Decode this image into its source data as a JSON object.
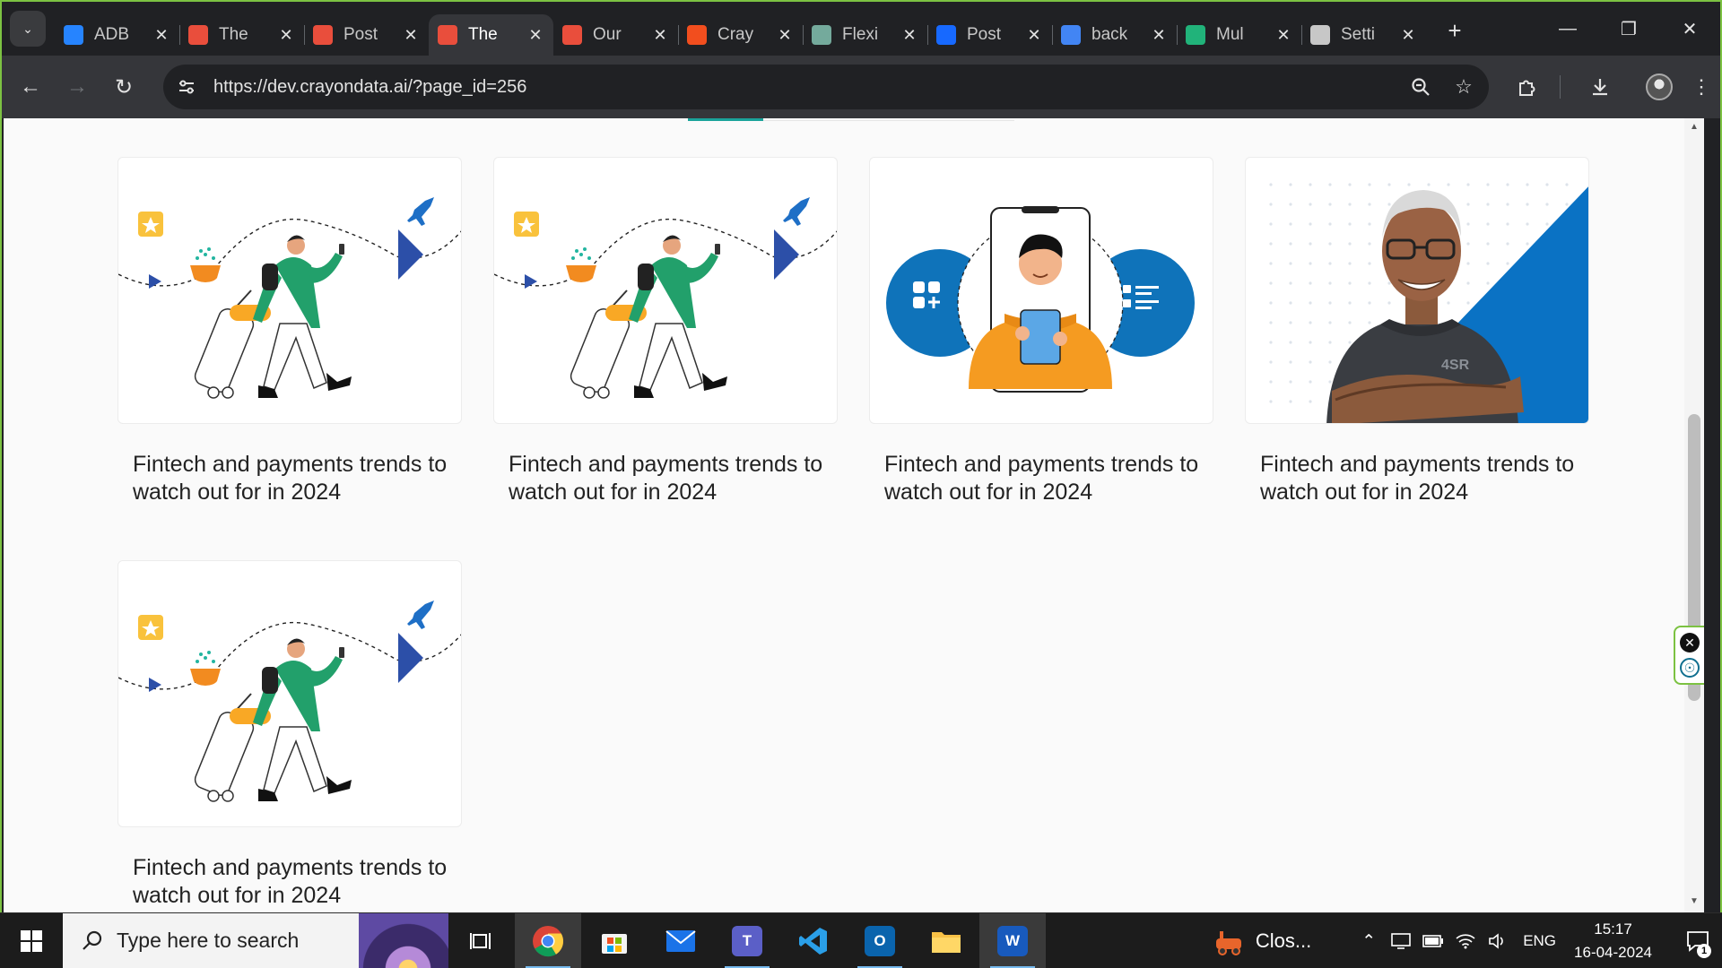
{
  "browser": {
    "tabs": [
      {
        "title": "ADB",
        "favicon": "jira-icon",
        "color": "#2684ff"
      },
      {
        "title": "The",
        "favicon": "crayon-icon",
        "color": "#e94e3c"
      },
      {
        "title": "Post",
        "favicon": "crayon-icon",
        "color": "#e94e3c"
      },
      {
        "title": "The",
        "favicon": "crayon-icon",
        "color": "#e94e3c",
        "active": true
      },
      {
        "title": "Our",
        "favicon": "crayon-icon",
        "color": "#e94e3c"
      },
      {
        "title": "Cray",
        "favicon": "figma-icon",
        "color": "#f24e1e"
      },
      {
        "title": "Flexi",
        "favicon": "openai-icon",
        "color": "#74aa9c"
      },
      {
        "title": "Post",
        "favicon": "behance-icon",
        "color": "#1769ff"
      },
      {
        "title": "back",
        "favicon": "google-icon",
        "color": "#4285f4"
      },
      {
        "title": "Mul",
        "favicon": "leaf-icon",
        "color": "#21b37a"
      },
      {
        "title": "Setti",
        "favicon": "gear-icon",
        "color": "#c7c7c7"
      }
    ],
    "url": "https://dev.crayondata.ai/?page_id=256"
  },
  "page": {
    "cards": [
      {
        "title": "Fintech and payments trends to watch out for in 2024",
        "image": "traveler-illustration"
      },
      {
        "title": "Fintech and payments trends to watch out for in 2024",
        "image": "traveler-illustration"
      },
      {
        "title": "Fintech and payments trends to watch out for in 2024",
        "image": "phone-user-illustration"
      },
      {
        "title": "Fintech and payments trends to watch out for in 2024",
        "image": "portrait-photo"
      },
      {
        "title": "Fintech and payments trends to watch out for in 2024",
        "image": "traveler-illustration"
      }
    ]
  },
  "taskbar": {
    "search_placeholder": "Type here to search",
    "weather_text": "Clos...",
    "language": "ENG",
    "time": "15:17",
    "date": "16-04-2024",
    "notification_count": "1"
  },
  "colors": {
    "accent_green": "#7cc242",
    "brand_blue": "#0072bc",
    "teal": "#1aa39a"
  }
}
